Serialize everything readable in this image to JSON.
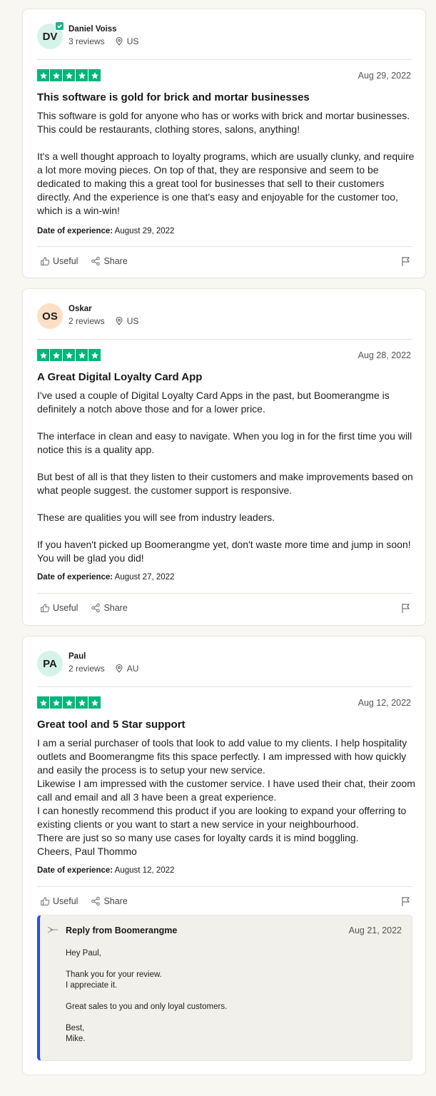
{
  "actions": {
    "useful": "Useful",
    "share": "Share"
  },
  "doe_label": "Date of experience:",
  "reviews": [
    {
      "initials": "DV",
      "avatar_color": "#d6f3ea",
      "verified": true,
      "name": "Daniel Voiss",
      "reviews_count": "3 reviews",
      "country": "US",
      "date": "Aug 29, 2022",
      "title": "This software is gold for brick and mortar businesses",
      "paragraphs": [
        "This software is gold for anyone who has or works with brick and mortar businesses. This could be restaurants, clothing stores, salons, anything!",
        "It's a well thought approach to loyalty programs, which are usually clunky, and require a lot more moving pieces. On top of that, they are responsive and seem to be dedicated to making this a great tool for businesses that sell to their customers directly. And the experience is one that's easy and enjoyable for the customer too, which is a win-win!"
      ],
      "experience_date": "August 29, 2022"
    },
    {
      "initials": "OS",
      "avatar_color": "#fde0c4",
      "verified": false,
      "name": "Oskar",
      "reviews_count": "2 reviews",
      "country": "US",
      "date": "Aug 28, 2022",
      "title": "A Great Digital Loyalty Card App",
      "paragraphs": [
        "I've used a couple of Digital Loyalty Card Apps in the past, but Boomerangme is definitely a notch above those and for a lower price.",
        "The interface in clean and easy to navigate. When you log in for the first time you will notice this is a quality app.",
        "But best of all is that they listen to their customers and make improvements based on what people suggest. the customer support is responsive.",
        "These are qualities you will see from industry leaders.",
        "If you haven't picked up Boomerangme yet, don't waste more time and jump in soon! You will be glad you did!"
      ],
      "experience_date": "August 27, 2022"
    },
    {
      "initials": "PA",
      "avatar_color": "#d6f3ea",
      "verified": false,
      "name": "Paul",
      "reviews_count": "2 reviews",
      "country": "AU",
      "date": "Aug 12, 2022",
      "title": "Great tool and 5 Star support",
      "lines": [
        "I am a serial purchaser of tools that look to add value to my clients. I help hospitality outlets and Boomerangme fits this space perfectly. I am impressed with how quickly and easily the process is to setup your new service.",
        "Likewise I am impressed with the customer service. I have used their chat, their zoom call and email and all 3 have been a great experience.",
        "I can honestly recommend this product if you are looking to expand your offerring to existing clients or you want to start a new service in your neighbourhood.",
        "There are just so so many use cases for loyalty cards it is mind boggling.",
        "Cheers, Paul Thommo"
      ],
      "experience_date": "August 12, 2022",
      "reply": {
        "from": "Reply from Boomerangme",
        "date": "Aug 21, 2022",
        "paragraphs": [
          [
            "Hey Paul,"
          ],
          [
            "Thank you for your review.",
            "I appreciate it."
          ],
          [
            "Great sales to you and only loyal customers."
          ],
          [
            "Best,",
            "Mike."
          ]
        ]
      }
    }
  ]
}
